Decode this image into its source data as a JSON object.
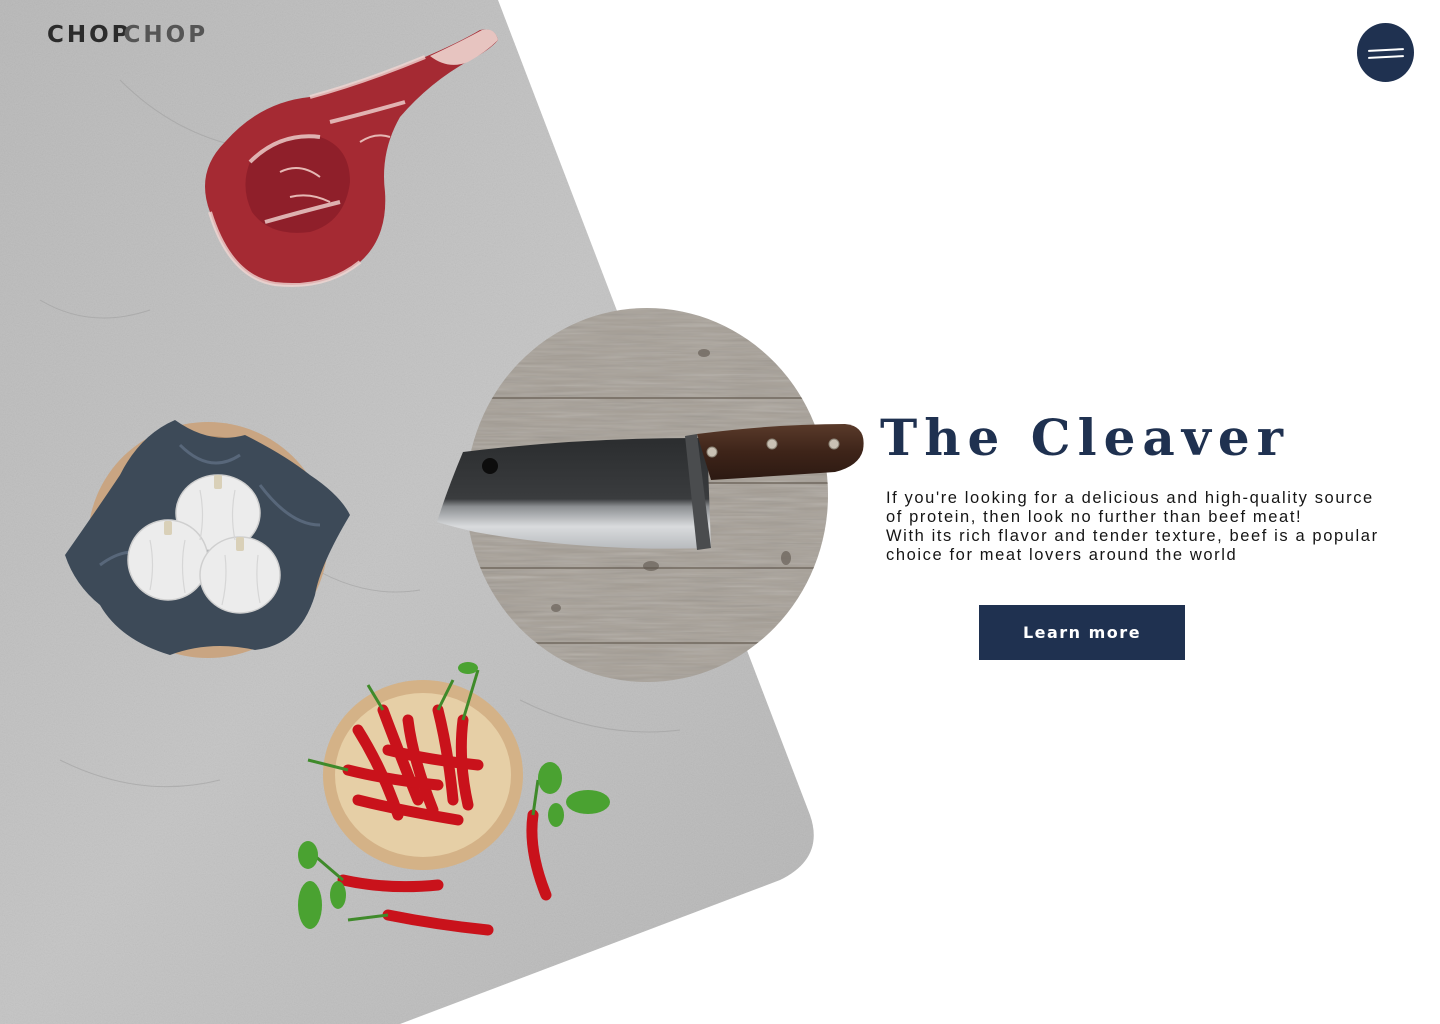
{
  "brand": {
    "logo_part1": "CHOP",
    "logo_part2": "CHOP"
  },
  "header": {
    "menu_icon": "hamburger-menu-icon"
  },
  "hero": {
    "title": "The Cleaver",
    "description_lines": [
      "If you're looking for a delicious and high-quality source",
      "of protein, then look no further than beef meat!",
      "With its rich flavor and tender texture, beef is a popular",
      "choice for meat lovers around the world"
    ],
    "cta_label": "Learn more"
  },
  "images": {
    "steak": "tomahawk-steak-image",
    "garlic": "garlic-bowl-image",
    "chili": "red-chili-bowl-image",
    "cleaver": "cleaver-knife-image",
    "board": "wooden-board-image"
  },
  "colors": {
    "accent": "#1f3150",
    "slab": "#bdbdbd",
    "background": "#ffffff",
    "text": "#151515"
  }
}
